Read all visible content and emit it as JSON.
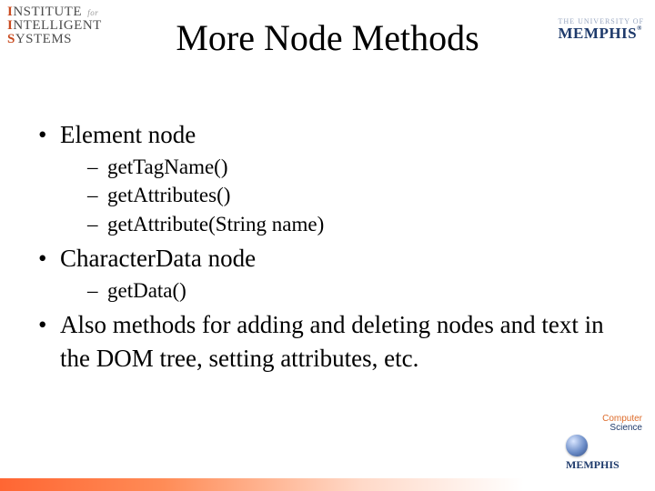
{
  "header": {
    "logo_left": {
      "line1_pre": "NSTITUTE",
      "line1_for": "for",
      "line2": "NTELLIGENT",
      "line3": "YSTEMS"
    },
    "logo_right": {
      "top": "THE UNIVERSITY OF",
      "main": "MEMPHIS"
    },
    "title": "More Node Methods"
  },
  "bullets": [
    {
      "text": "Element node",
      "sub": [
        "getTagName()",
        "getAttributes()",
        "getAttribute(String name)"
      ]
    },
    {
      "text": "CharacterData node",
      "sub": [
        "getData()"
      ]
    },
    {
      "text": "Also methods for adding and deleting nodes and text in the DOM tree, setting attributes, etc.",
      "sub": []
    }
  ],
  "footer_badge": {
    "cs_word1": "Computer",
    "cs_word2": "Science",
    "memphis": "MEMPHIS"
  }
}
